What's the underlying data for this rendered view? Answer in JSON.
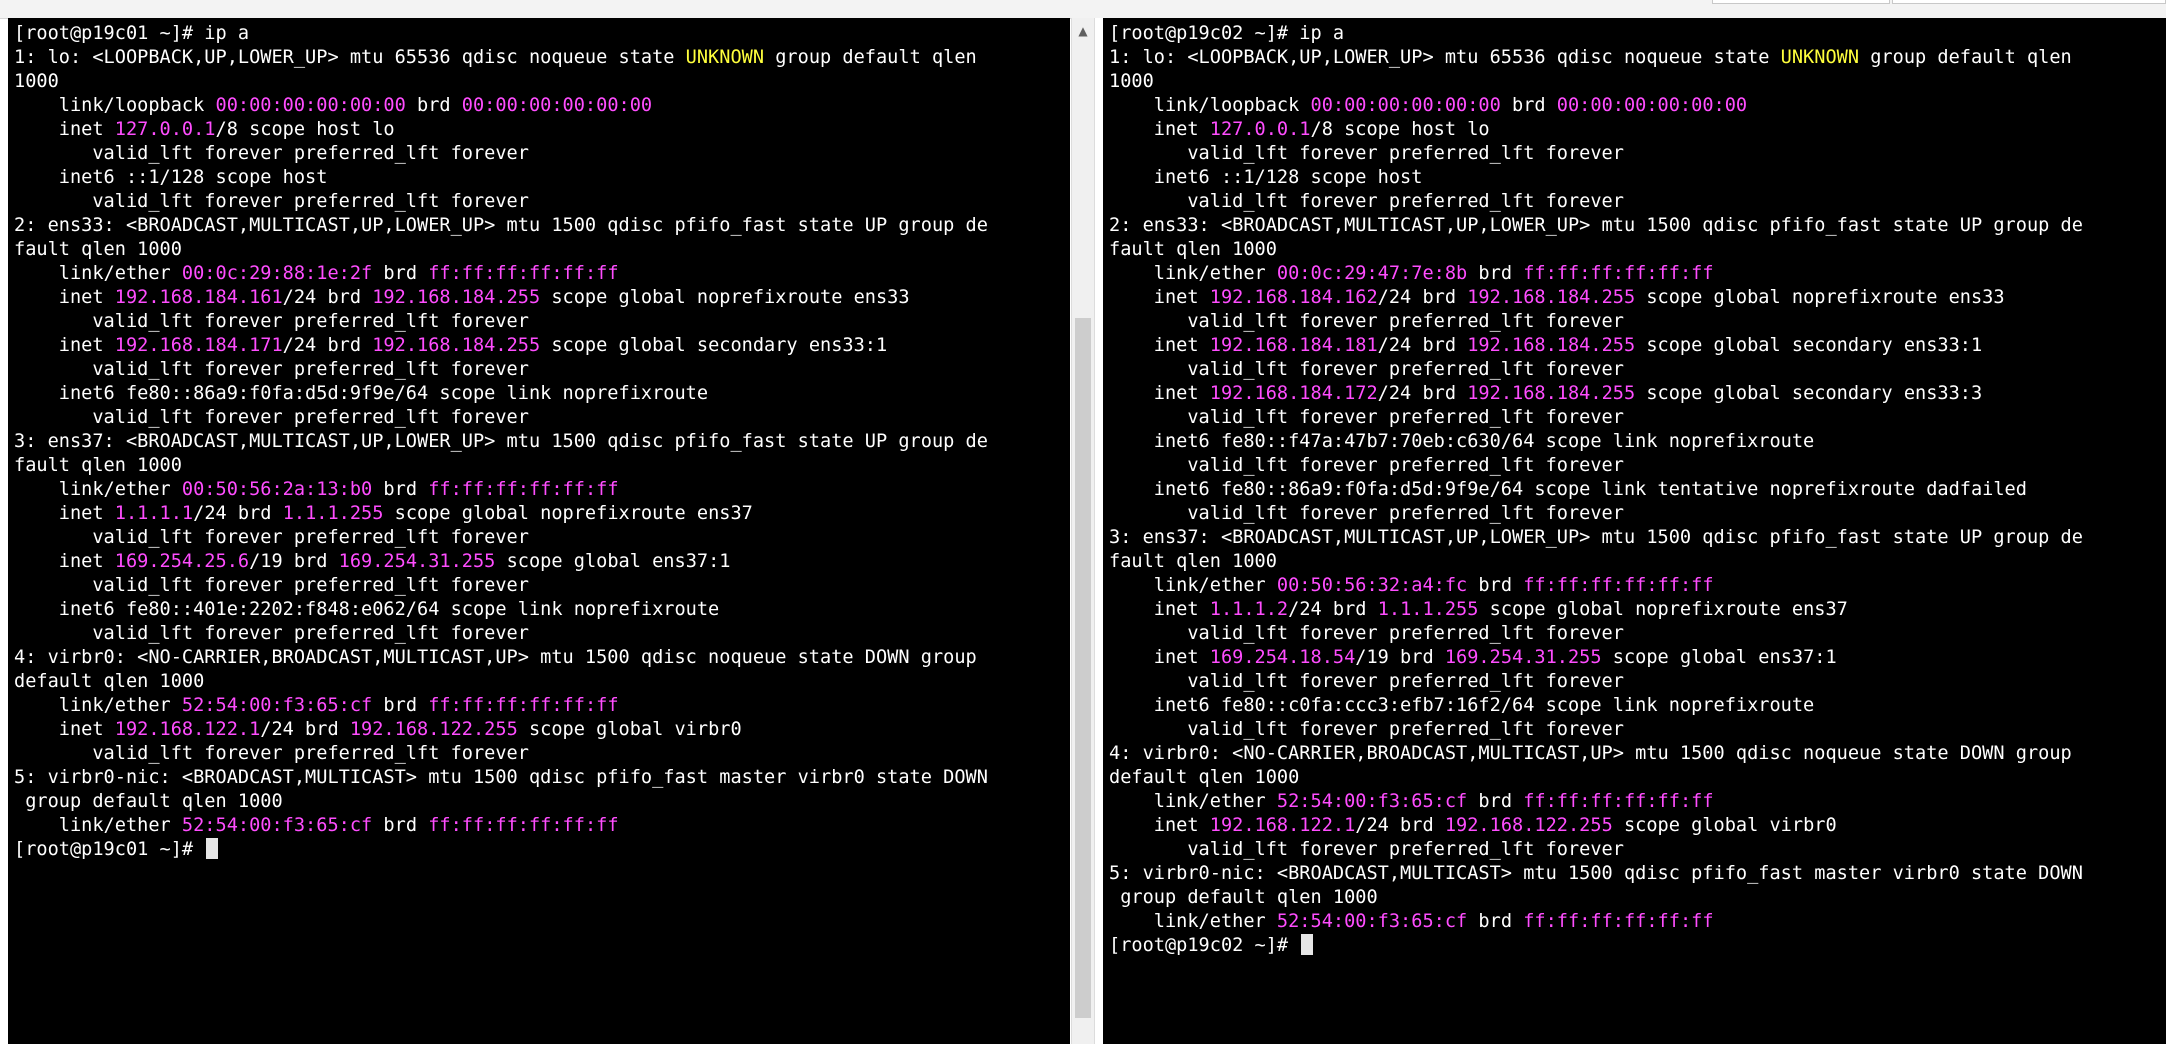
{
  "colors": {
    "terminal_bg": "#000000",
    "text": "#ffffff",
    "ip_mac_highlight": "#ff4dff",
    "state_unknown": "#ffff3c"
  },
  "panes": [
    {
      "name": "p19c01",
      "lines": [
        [
          [
            "[root@p19c01 ~]# ip a",
            "w"
          ]
        ],
        [
          [
            "1: lo: <LOOPBACK,UP,LOWER_UP> mtu 65536 qdisc noqueue state ",
            "w"
          ],
          [
            "UNKNOWN",
            "y"
          ],
          [
            " group default qlen",
            "w"
          ]
        ],
        [
          [
            "1000",
            "w"
          ]
        ],
        [
          [
            "    link/loopback ",
            "w"
          ],
          [
            "00:00:00:00:00:00",
            "m"
          ],
          [
            " brd ",
            "w"
          ],
          [
            "00:00:00:00:00:00",
            "m"
          ]
        ],
        [
          [
            "    inet ",
            "w"
          ],
          [
            "127.0.0.1",
            "m"
          ],
          [
            "/8 scope host lo",
            "w"
          ]
        ],
        [
          [
            "       valid_lft forever preferred_lft forever",
            "w"
          ]
        ],
        [
          [
            "    inet6 ::1/128 scope host",
            "w"
          ]
        ],
        [
          [
            "       valid_lft forever preferred_lft forever",
            "w"
          ]
        ],
        [
          [
            "2: ens33: <BROADCAST,MULTICAST,UP,LOWER_UP> mtu 1500 qdisc pfifo_fast state UP group de",
            "w"
          ]
        ],
        [
          [
            "fault qlen 1000",
            "w"
          ]
        ],
        [
          [
            "    link/ether ",
            "w"
          ],
          [
            "00:0c:29:88:1e:2f",
            "m"
          ],
          [
            " brd ",
            "w"
          ],
          [
            "ff:ff:ff:ff:ff:ff",
            "m"
          ]
        ],
        [
          [
            "    inet ",
            "w"
          ],
          [
            "192.168.184.161",
            "m"
          ],
          [
            "/24 brd ",
            "w"
          ],
          [
            "192.168.184.255",
            "m"
          ],
          [
            " scope global noprefixroute ens33",
            "w"
          ]
        ],
        [
          [
            "       valid_lft forever preferred_lft forever",
            "w"
          ]
        ],
        [
          [
            "    inet ",
            "w"
          ],
          [
            "192.168.184.171",
            "m"
          ],
          [
            "/24 brd ",
            "w"
          ],
          [
            "192.168.184.255",
            "m"
          ],
          [
            " scope global secondary ens33:1",
            "w"
          ]
        ],
        [
          [
            "       valid_lft forever preferred_lft forever",
            "w"
          ]
        ],
        [
          [
            "    inet6 fe80::86a9:f0fa:d5d:9f9e/64 scope link noprefixroute",
            "w"
          ]
        ],
        [
          [
            "       valid_lft forever preferred_lft forever",
            "w"
          ]
        ],
        [
          [
            "3: ens37: <BROADCAST,MULTICAST,UP,LOWER_UP> mtu 1500 qdisc pfifo_fast state UP group de",
            "w"
          ]
        ],
        [
          [
            "fault qlen 1000",
            "w"
          ]
        ],
        [
          [
            "    link/ether ",
            "w"
          ],
          [
            "00:50:56:2a:13:b0",
            "m"
          ],
          [
            " brd ",
            "w"
          ],
          [
            "ff:ff:ff:ff:ff:ff",
            "m"
          ]
        ],
        [
          [
            "    inet ",
            "w"
          ],
          [
            "1.1.1.1",
            "m"
          ],
          [
            "/24 brd ",
            "w"
          ],
          [
            "1.1.1.255",
            "m"
          ],
          [
            " scope global noprefixroute ens37",
            "w"
          ]
        ],
        [
          [
            "       valid_lft forever preferred_lft forever",
            "w"
          ]
        ],
        [
          [
            "    inet ",
            "w"
          ],
          [
            "169.254.25.6",
            "m"
          ],
          [
            "/19 brd ",
            "w"
          ],
          [
            "169.254.31.255",
            "m"
          ],
          [
            " scope global ens37:1",
            "w"
          ]
        ],
        [
          [
            "       valid_lft forever preferred_lft forever",
            "w"
          ]
        ],
        [
          [
            "    inet6 fe80::401e:2202:f848:e062/64 scope link noprefixroute",
            "w"
          ]
        ],
        [
          [
            "       valid_lft forever preferred_lft forever",
            "w"
          ]
        ],
        [
          [
            "4: virbr0: <NO-CARRIER,BROADCAST,MULTICAST,UP> mtu 1500 qdisc noqueue state DOWN group",
            "w"
          ]
        ],
        [
          [
            "default qlen 1000",
            "w"
          ]
        ],
        [
          [
            "    link/ether ",
            "w"
          ],
          [
            "52:54:00:f3:65:cf",
            "m"
          ],
          [
            " brd ",
            "w"
          ],
          [
            "ff:ff:ff:ff:ff:ff",
            "m"
          ]
        ],
        [
          [
            "    inet ",
            "w"
          ],
          [
            "192.168.122.1",
            "m"
          ],
          [
            "/24 brd ",
            "w"
          ],
          [
            "192.168.122.255",
            "m"
          ],
          [
            " scope global virbr0",
            "w"
          ]
        ],
        [
          [
            "       valid_lft forever preferred_lft forever",
            "w"
          ]
        ],
        [
          [
            "5: virbr0-nic: <BROADCAST,MULTICAST> mtu 1500 qdisc pfifo_fast master virbr0 state DOWN",
            "w"
          ]
        ],
        [
          [
            " group default qlen 1000",
            "w"
          ]
        ],
        [
          [
            "    link/ether ",
            "w"
          ],
          [
            "52:54:00:f3:65:cf",
            "m"
          ],
          [
            " brd ",
            "w"
          ],
          [
            "ff:ff:ff:ff:ff:ff",
            "m"
          ]
        ],
        [
          [
            "[root@p19c01 ~]# ",
            "w"
          ],
          [
            "",
            "cursor"
          ]
        ]
      ]
    },
    {
      "name": "p19c02",
      "lines": [
        [
          [
            "[root@p19c02 ~]# ip a",
            "w"
          ]
        ],
        [
          [
            "1: lo: <LOOPBACK,UP,LOWER_UP> mtu 65536 qdisc noqueue state ",
            "w"
          ],
          [
            "UNKNOWN",
            "y"
          ],
          [
            " group default qlen",
            "w"
          ]
        ],
        [
          [
            "1000",
            "w"
          ]
        ],
        [
          [
            "    link/loopback ",
            "w"
          ],
          [
            "00:00:00:00:00:00",
            "m"
          ],
          [
            " brd ",
            "w"
          ],
          [
            "00:00:00:00:00:00",
            "m"
          ]
        ],
        [
          [
            "    inet ",
            "w"
          ],
          [
            "127.0.0.1",
            "m"
          ],
          [
            "/8 scope host lo",
            "w"
          ]
        ],
        [
          [
            "       valid_lft forever preferred_lft forever",
            "w"
          ]
        ],
        [
          [
            "    inet6 ::1/128 scope host",
            "w"
          ]
        ],
        [
          [
            "       valid_lft forever preferred_lft forever",
            "w"
          ]
        ],
        [
          [
            "2: ens33: <BROADCAST,MULTICAST,UP,LOWER_UP> mtu 1500 qdisc pfifo_fast state UP group de",
            "w"
          ]
        ],
        [
          [
            "fault qlen 1000",
            "w"
          ]
        ],
        [
          [
            "    link/ether ",
            "w"
          ],
          [
            "00:0c:29:47:7e:8b",
            "m"
          ],
          [
            " brd ",
            "w"
          ],
          [
            "ff:ff:ff:ff:ff:ff",
            "m"
          ]
        ],
        [
          [
            "    inet ",
            "w"
          ],
          [
            "192.168.184.162",
            "m"
          ],
          [
            "/24 brd ",
            "w"
          ],
          [
            "192.168.184.255",
            "m"
          ],
          [
            " scope global noprefixroute ens33",
            "w"
          ]
        ],
        [
          [
            "       valid_lft forever preferred_lft forever",
            "w"
          ]
        ],
        [
          [
            "    inet ",
            "w"
          ],
          [
            "192.168.184.181",
            "m"
          ],
          [
            "/24 brd ",
            "w"
          ],
          [
            "192.168.184.255",
            "m"
          ],
          [
            " scope global secondary ens33:1",
            "w"
          ]
        ],
        [
          [
            "       valid_lft forever preferred_lft forever",
            "w"
          ]
        ],
        [
          [
            "    inet ",
            "w"
          ],
          [
            "192.168.184.172",
            "m"
          ],
          [
            "/24 brd ",
            "w"
          ],
          [
            "192.168.184.255",
            "m"
          ],
          [
            " scope global secondary ens33:3",
            "w"
          ]
        ],
        [
          [
            "       valid_lft forever preferred_lft forever",
            "w"
          ]
        ],
        [
          [
            "    inet6 fe80::f47a:47b7:70eb:c630/64 scope link noprefixroute",
            "w"
          ]
        ],
        [
          [
            "       valid_lft forever preferred_lft forever",
            "w"
          ]
        ],
        [
          [
            "    inet6 fe80::86a9:f0fa:d5d:9f9e/64 scope link tentative noprefixroute dadfailed",
            "w"
          ]
        ],
        [
          [
            "       valid_lft forever preferred_lft forever",
            "w"
          ]
        ],
        [
          [
            "3: ens37: <BROADCAST,MULTICAST,UP,LOWER_UP> mtu 1500 qdisc pfifo_fast state UP group de",
            "w"
          ]
        ],
        [
          [
            "fault qlen 1000",
            "w"
          ]
        ],
        [
          [
            "    link/ether ",
            "w"
          ],
          [
            "00:50:56:32:a4:fc",
            "m"
          ],
          [
            " brd ",
            "w"
          ],
          [
            "ff:ff:ff:ff:ff:ff",
            "m"
          ]
        ],
        [
          [
            "    inet ",
            "w"
          ],
          [
            "1.1.1.2",
            "m"
          ],
          [
            "/24 brd ",
            "w"
          ],
          [
            "1.1.1.255",
            "m"
          ],
          [
            " scope global noprefixroute ens37",
            "w"
          ]
        ],
        [
          [
            "       valid_lft forever preferred_lft forever",
            "w"
          ]
        ],
        [
          [
            "    inet ",
            "w"
          ],
          [
            "169.254.18.54",
            "m"
          ],
          [
            "/19 brd ",
            "w"
          ],
          [
            "169.254.31.255",
            "m"
          ],
          [
            " scope global ens37:1",
            "w"
          ]
        ],
        [
          [
            "       valid_lft forever preferred_lft forever",
            "w"
          ]
        ],
        [
          [
            "    inet6 fe80::c0fa:ccc3:efb7:16f2/64 scope link noprefixroute",
            "w"
          ]
        ],
        [
          [
            "       valid_lft forever preferred_lft forever",
            "w"
          ]
        ],
        [
          [
            "4: virbr0: <NO-CARRIER,BROADCAST,MULTICAST,UP> mtu 1500 qdisc noqueue state DOWN group",
            "w"
          ]
        ],
        [
          [
            "default qlen 1000",
            "w"
          ]
        ],
        [
          [
            "    link/ether ",
            "w"
          ],
          [
            "52:54:00:f3:65:cf",
            "m"
          ],
          [
            " brd ",
            "w"
          ],
          [
            "ff:ff:ff:ff:ff:ff",
            "m"
          ]
        ],
        [
          [
            "    inet ",
            "w"
          ],
          [
            "192.168.122.1",
            "m"
          ],
          [
            "/24 brd ",
            "w"
          ],
          [
            "192.168.122.255",
            "m"
          ],
          [
            " scope global virbr0",
            "w"
          ]
        ],
        [
          [
            "       valid_lft forever preferred_lft forever",
            "w"
          ]
        ],
        [
          [
            "5: virbr0-nic: <BROADCAST,MULTICAST> mtu 1500 qdisc pfifo_fast master virbr0 state DOWN",
            "w"
          ]
        ],
        [
          [
            " group default qlen 1000",
            "w"
          ]
        ],
        [
          [
            "    link/ether ",
            "w"
          ],
          [
            "52:54:00:f3:65:cf",
            "m"
          ],
          [
            " brd ",
            "w"
          ],
          [
            "ff:ff:ff:ff:ff:ff",
            "m"
          ]
        ],
        [
          [
            "[root@p19c02 ~]# ",
            "w"
          ],
          [
            "",
            "cursor"
          ]
        ]
      ]
    }
  ]
}
